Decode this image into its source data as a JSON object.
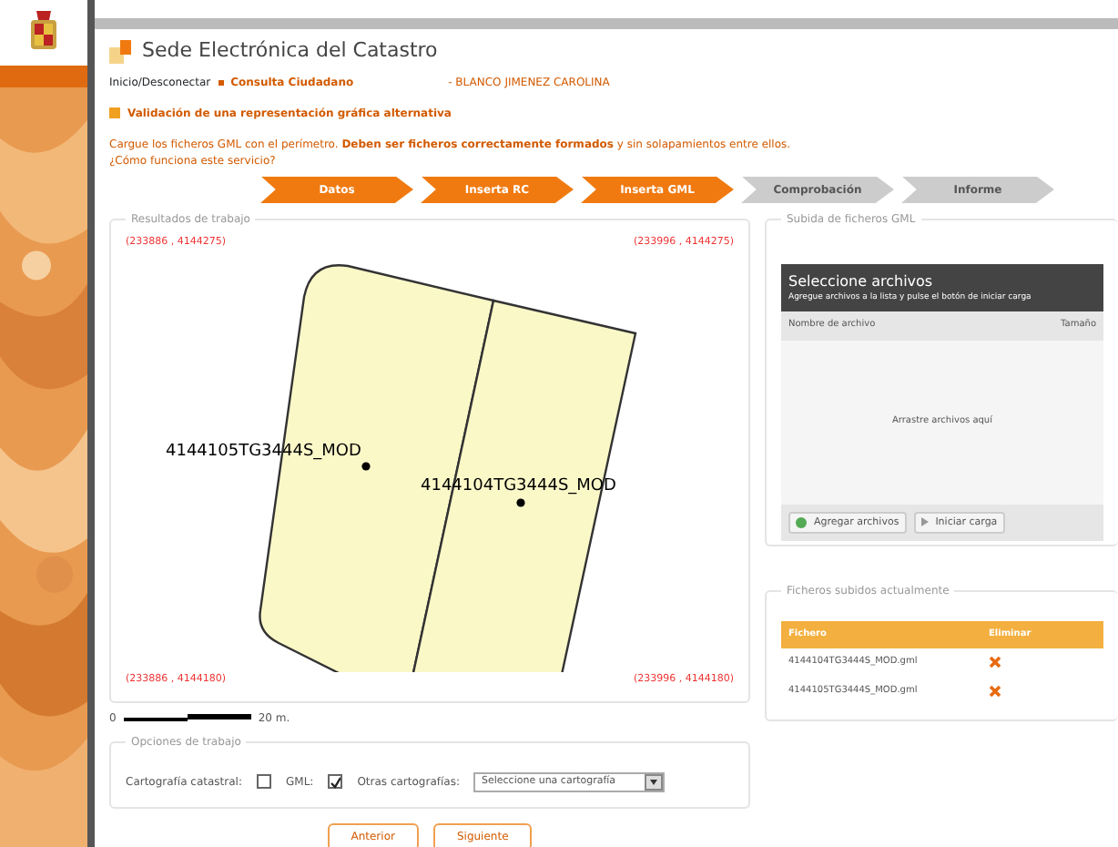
{
  "header": {
    "title": "Sede Electrónica del Catastro",
    "nav": [
      {
        "label": "Inicio/Desconectar"
      },
      {
        "label": "Consulta Ciudadano"
      }
    ],
    "user": "- BLANCO JIMENEZ CAROLINA"
  },
  "page_title": "Validación de una representación gráfica alternativa",
  "instructions": "Cargue los ficheros GML con el perímetro. **Deben ser ficheros correctamente formados** y sin solapamientos entre ellos.",
  "help_link": "¿Cómo funciona este servicio?",
  "steps": [
    {
      "label": "Datos",
      "done": true
    },
    {
      "label": "Inserta RC",
      "done": true
    },
    {
      "label": "Inserta GML",
      "done": true
    },
    {
      "label": "Comprobación",
      "done": false
    },
    {
      "label": "Informe",
      "done": false
    }
  ],
  "results": {
    "legend": "Resultados de trabajo",
    "corners": [
      "(233886 , 4144275)",
      "(233996 , 4144275)",
      "(233886 , 4144180)",
      "(233996 , 4144180)"
    ],
    "parcels": [
      {
        "label": "4144105TG3444S_MOD"
      },
      {
        "label": "4144104TG3444S_MOD"
      }
    ],
    "scale": {
      "start": "0",
      "end": "20 m."
    }
  },
  "options": {
    "legend": "Opciones de trabajo",
    "catastral": {
      "label": "Cartografía catastral:",
      "checked": false
    },
    "gml": {
      "label": "GML:",
      "checked": true
    },
    "other": {
      "label": "Otras cartografías:",
      "placeholder": "Seleccione una cartografía"
    }
  },
  "buttons": [
    "Anterior",
    "Siguiente"
  ],
  "upload": {
    "legend": "Subida de ficheros GML",
    "title": "Seleccione archivos",
    "subtitle": "Agregue archivos a la lista y pulse el botón de iniciar carga",
    "columns": [
      "Nombre de archivo",
      "Tamaño"
    ],
    "drop_text": "Arrastre archivos aquí",
    "add_button": "Agregar archivos",
    "start_button": "Iniciar carga"
  },
  "uploaded": {
    "legend": "Ficheros subidos actualmente",
    "columns": [
      "Fichero",
      "Eliminar"
    ],
    "rows": [
      {
        "file": "4144104TG3444S_MOD.gml"
      },
      {
        "file": "4144105TG3444S_MOD.gml"
      }
    ]
  }
}
